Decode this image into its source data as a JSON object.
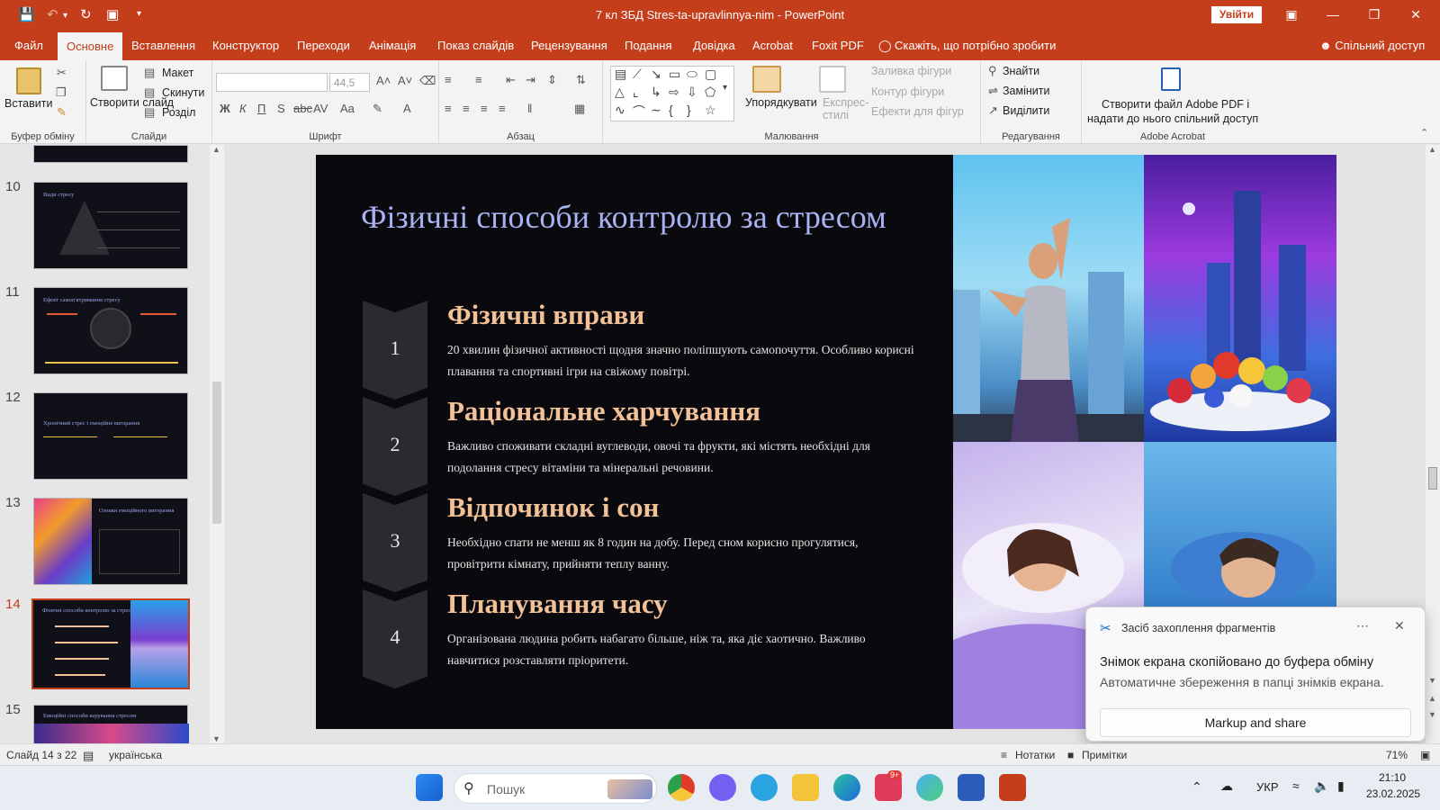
{
  "titlebar": {
    "document_title": "7 кл ЗБД Stres-ta-upravlinnya-nim  -  PowerPoint",
    "signin_label": "Увійти",
    "window_buttons": [
      "restore-ribbon",
      "minimize",
      "maximize",
      "close"
    ]
  },
  "tabs": [
    "Файл",
    "Основне",
    "Вставлення",
    "Конструктор",
    "Переходи",
    "Анімація",
    "Показ слайдів",
    "Рецензування",
    "Подання",
    "Довідка",
    "Acrobat",
    "Foxit PDF"
  ],
  "active_tab": "Основне",
  "tell_me": "Скажіть, що потрібно зробити",
  "share_label": "Спільний доступ",
  "ribbon": {
    "clipboard": {
      "paste": "Вставити",
      "label": "Буфер обміну"
    },
    "slides": {
      "new_slide": "Створити слайд",
      "layout": "Макет",
      "reset": "Скинути",
      "section": "Розділ",
      "label": "Слайди"
    },
    "font": {
      "font_name": "",
      "font_size": "44,5",
      "label": "Шрифт"
    },
    "paragraph": {
      "label": "Абзац"
    },
    "drawing": {
      "arrange": "Упорядкувати",
      "quick_styles": "Експрес-стилі",
      "fill": "Заливка фігури",
      "outline": "Контур фігури",
      "effects": "Ефекти для фігур",
      "label": "Малювання"
    },
    "editing": {
      "find": "Знайти",
      "replace": "Замінити",
      "select": "Виділити",
      "label": "Редагування"
    },
    "acrobat": {
      "create_pdf_line1": "Створити файл Adobe PDF і",
      "create_pdf_line2": "надати до нього спільний доступ",
      "label": "Adobe Acrobat"
    }
  },
  "thumbnails": [
    {
      "num": "10",
      "title": "Види стресу"
    },
    {
      "num": "11",
      "title": "Ефект самоп'ятримання стресу"
    },
    {
      "num": "12",
      "title": "Хронічний стрес і емоційне вигорання"
    },
    {
      "num": "13",
      "title": "Ознаки емоційного вигорання"
    },
    {
      "num": "14",
      "title": "Фізичні способи контролю за стресом",
      "selected": true
    },
    {
      "num": "15",
      "title": "Емоційні способи керування стресом"
    }
  ],
  "slide": {
    "title": "Фізичні способи контролю за стресом",
    "items": [
      {
        "num": "1",
        "heading": "Фізичні вправи",
        "body": "20 хвилин фізичної активності щодня значно поліпшують самопочуття. Особливо корисні плавання та спортивні ігри на свіжому повітрі."
      },
      {
        "num": "2",
        "heading": "Раціональне харчування",
        "body": "Важливо споживати складні вуглеводи, овочі та фрукти, які містять необхідні для подолання стресу вітаміни та мінеральні речовини."
      },
      {
        "num": "3",
        "heading": "Відпочинок і сон",
        "body": "Необхідно спати не менш як 8 годин на добу. Перед сном корисно прогулятися, провітрити кімнату, прийняти теплу ванну."
      },
      {
        "num": "4",
        "heading": "Планування часу",
        "body": "Організована людина робить набагато більше, ніж та, яка діє хаотично. Важливо навчитися розставляти пріоритети."
      }
    ],
    "photos": [
      "woman-stretching-city",
      "fruit-bowl-city",
      "woman-sleeping",
      "man-sleeping"
    ]
  },
  "statusbar": {
    "slide_indicator": "Слайд 14 з 22",
    "language": "українська",
    "notes": "Нотатки",
    "comments": "Примітки",
    "zoom": "71%"
  },
  "toast": {
    "app_name": "Засіб захоплення фрагментів",
    "message": "Знімок екрана скопійовано до буфера обміну",
    "sub_message": "Автоматичне збереження в папці знімків екрана.",
    "button": "Markup and share"
  },
  "taskbar": {
    "search_placeholder": "Пошук",
    "skype_badge": "9+",
    "language": "УКР",
    "time": "21:10",
    "date": "23.02.2025"
  },
  "colors": {
    "office_accent": "#c43e1c",
    "slide_bg": "#0a090d",
    "slide_title": "#a9b2f3",
    "heading": "#f3c197"
  }
}
